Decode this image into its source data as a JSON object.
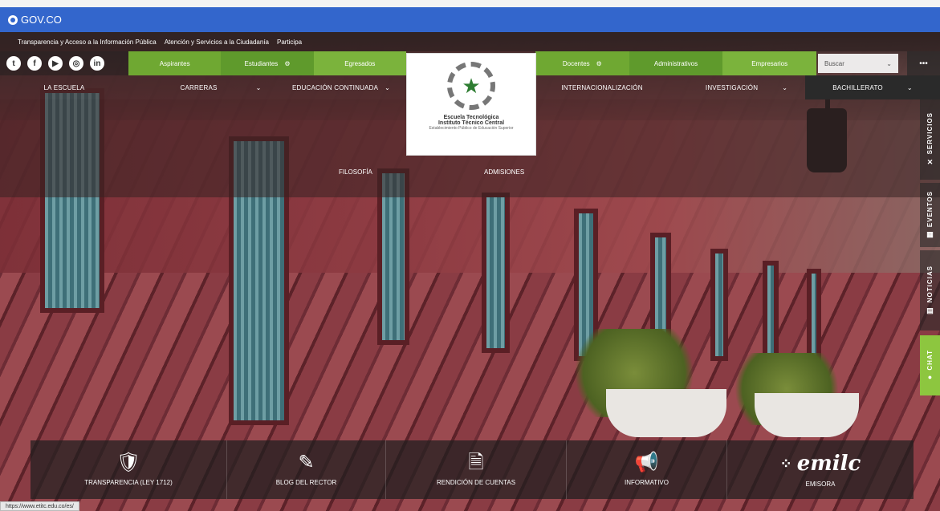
{
  "gov": {
    "label": "GOV.CO"
  },
  "transparency_bar": {
    "links": [
      "Transparencia y Acceso a la Información Pública",
      "Atención y Servicios a la Ciudadanía",
      "Participa"
    ]
  },
  "social_icons": [
    "twitter-icon",
    "facebook-icon",
    "youtube-icon",
    "instagram-icon",
    "linkedin-icon"
  ],
  "audiences_left": [
    "Aspirantes",
    "Estudiantes",
    "Egresados"
  ],
  "audiences_right": [
    "Docentes",
    "Administrativos",
    "Empresarios"
  ],
  "search": {
    "label": "Buscar"
  },
  "main_menu": {
    "escuela": "LA ESCUELA",
    "carreras": "CARRERAS",
    "educacion": "EDUCACIÓN CONTINUADA",
    "internacionalizacion": "INTERNACIONALIZACIÓN",
    "investigacion": "INVESTIGACIÓN",
    "bachillerato": "BACHILLERATO"
  },
  "submenu": {
    "filosofia": "FILOSOFÍA",
    "admisiones": "ADMISIONES"
  },
  "logo": {
    "line1": "Escuela Tecnológica",
    "line2": "Instituto Técnico Central",
    "line3": "Establecimiento Público de Educación Superior"
  },
  "right_rail": {
    "servicios": "SERVICIOS",
    "eventos": "EVENTOS",
    "noticias": "NOTICIAS",
    "chat": "CHAT"
  },
  "quick_links": {
    "transparencia": "TRANSPARENCIA (LEY 1712)",
    "blog": "BLOG DEL RECTOR",
    "rendicion": "RENDICIÓN DE CUENTAS",
    "informativo": "INFORMATIVO",
    "emisora": "EMISORA",
    "emilc_logo": "emilc"
  },
  "status_url": "https://www.etitc.edu.co/es/"
}
